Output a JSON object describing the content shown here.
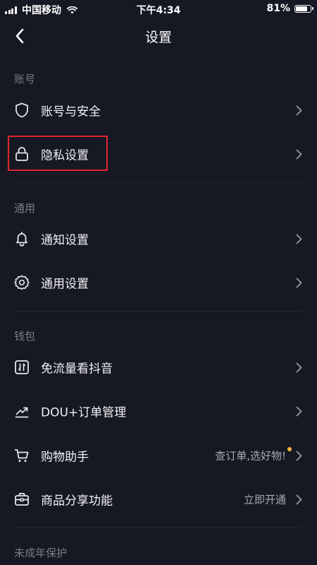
{
  "status_bar": {
    "carrier": "中国移动",
    "time": "下午4:34",
    "battery": "81%",
    "battery_level": 0.81
  },
  "nav": {
    "title": "设置",
    "back_icon": "chevron-left-icon"
  },
  "sections": {
    "account": {
      "header": "账号",
      "items": [
        {
          "label": "账号与安全",
          "icon": "shield-icon"
        },
        {
          "label": "隐私设置",
          "icon": "lock-icon",
          "highlighted": true
        }
      ]
    },
    "general": {
      "header": "通用",
      "items": [
        {
          "label": "通知设置",
          "icon": "bell-icon"
        },
        {
          "label": "通用设置",
          "icon": "gear-icon"
        }
      ]
    },
    "wallet": {
      "header": "钱包",
      "items": [
        {
          "label": "免流量看抖音",
          "icon": "data-card-icon"
        },
        {
          "label": "DOU+订单管理",
          "icon": "trend-up-icon"
        },
        {
          "label": "购物助手",
          "icon": "cart-icon",
          "trailing": "查订单,选好物!",
          "badge_dot": true
        },
        {
          "label": "商品分享功能",
          "icon": "briefcase-icon",
          "trailing": "立即开通"
        }
      ]
    },
    "minor": {
      "header": "未成年保护"
    }
  },
  "colors": {
    "background": "#161823",
    "highlight": "#e0242d",
    "badge_dot": "#f3b43c",
    "section_header": "#7a7c86"
  }
}
